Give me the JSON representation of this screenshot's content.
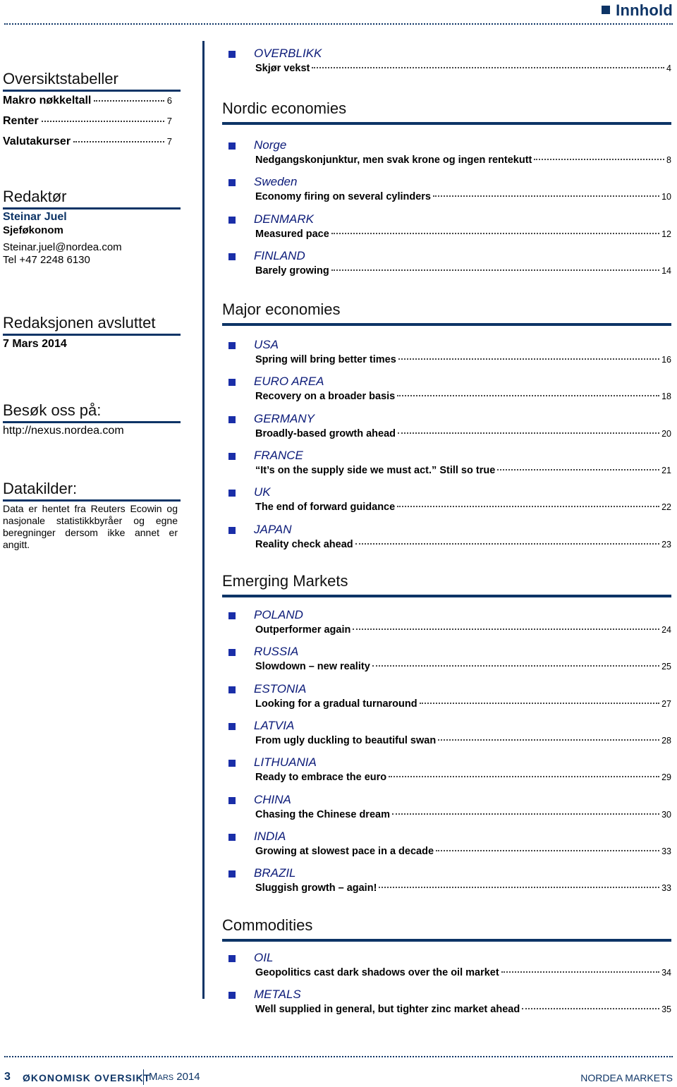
{
  "header": {
    "title": "Innhold"
  },
  "left": {
    "overview": {
      "heading": "Oversiktstabeller",
      "items": [
        {
          "label": "Makro nøkkeltall",
          "page": "6"
        },
        {
          "label": "Renter",
          "page": "7"
        },
        {
          "label": "Valutakurser",
          "page": "7"
        }
      ]
    },
    "editor": {
      "heading": "Redaktør",
      "name": "Steinar Juel",
      "role": "Sjeføkonom",
      "email": "Steinar.juel@nordea.com",
      "phone": "Tel +47 2248 6130"
    },
    "closed": {
      "heading": "Redaksjonen avsluttet",
      "date": "7 Mars 2014"
    },
    "visit": {
      "heading": "Besøk oss på:",
      "url": "http://nexus.nordea.com"
    },
    "sources": {
      "heading": "Datakilder:",
      "text": "Data er hentet fra Reuters Ecowin og nasjonale statistikkbyråer og egne beregninger dersom ikke annet er angitt."
    }
  },
  "overview": {
    "country": "OVERBLIKK",
    "title": "Skjør vekst",
    "page": "4"
  },
  "sections": [
    {
      "heading": "Nordic economies",
      "entries": [
        {
          "country": "Norge",
          "title": "Nedgangskonjunktur, men svak krone og ingen rentekutt",
          "page": "8"
        },
        {
          "country": "Sweden",
          "title": "Economy firing on several cylinders",
          "page": "10"
        },
        {
          "country": "DENMARK",
          "title": "Measured pace",
          "page": "12"
        },
        {
          "country": "FINLAND",
          "title": "Barely growing",
          "page": "14"
        }
      ]
    },
    {
      "heading": "Major economies",
      "entries": [
        {
          "country": "USA",
          "title": "Spring will bring better times",
          "page": "16"
        },
        {
          "country": "EURO AREA",
          "title": "Recovery on a broader basis",
          "page": "18"
        },
        {
          "country": "GERMANY",
          "title": "Broadly-based growth ahead",
          "page": "20"
        },
        {
          "country": "FRANCE",
          "title": "“It’s on the supply side we must act.” Still so true",
          "page": "21"
        },
        {
          "country": "UK",
          "title": "The end of forward guidance",
          "page": "22"
        },
        {
          "country": "JAPAN",
          "title": "Reality check ahead",
          "page": "23"
        }
      ]
    },
    {
      "heading": "Emerging Markets",
      "entries": [
        {
          "country": "POLAND",
          "title": "Outperformer again",
          "page": "24"
        },
        {
          "country": "RUSSIA",
          "title": "Slowdown – new reality",
          "page": "25"
        },
        {
          "country": "ESTONIA",
          "title": "Looking for a gradual turnaround",
          "page": "27"
        },
        {
          "country": "LATVIA",
          "title": "From ugly duckling to beautiful swan",
          "page": "28"
        },
        {
          "country": "LITHUANIA",
          "title": "Ready to embrace the euro",
          "page": "29"
        },
        {
          "country": "CHINA",
          "title": "Chasing the Chinese dream",
          "page": "30"
        },
        {
          "country": "INDIA",
          "title": "Growing at slowest pace in a decade",
          "page": "33"
        },
        {
          "country": "BRAZIL",
          "title": "Sluggish growth – again!",
          "page": "33"
        }
      ]
    },
    {
      "heading": "Commodities",
      "entries": [
        {
          "country": "OIL",
          "title": "Geopolitics cast dark shadows over the oil market",
          "page": "34"
        },
        {
          "country": "METALS",
          "title": "Well supplied in general, but tighter zinc market ahead",
          "page": "35"
        }
      ]
    }
  ],
  "footer": {
    "page_number": "3",
    "publication": "ØKONOMISK OVERSIKT",
    "date": "Mars 2014",
    "brand": "NORDEA MARKETS"
  },
  "colors": {
    "brand_navy": "#0d3466",
    "country_blue": "#0b1a78",
    "bullet_blue": "#1a2ea8"
  }
}
